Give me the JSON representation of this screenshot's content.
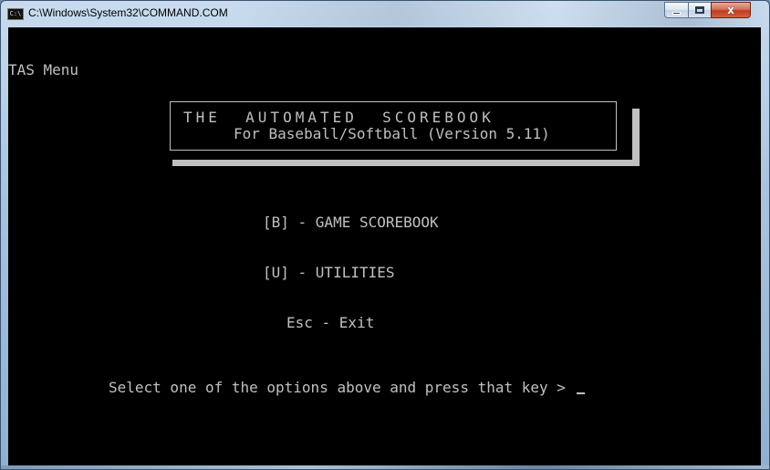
{
  "window": {
    "title": "C:\\Windows\\System32\\COMMAND.COM",
    "icon_text": "C:\\",
    "controls": {
      "minimize": "minimize-icon",
      "maximize": "maximize-icon",
      "close": "close-icon",
      "close_glyph": "x"
    }
  },
  "console": {
    "menu_title": "TAS Menu",
    "banner": {
      "title": "THE  AUTOMATED  SCOREBOOK",
      "subtitle": "For Baseball/Softball (Version 5.11)"
    },
    "options": [
      {
        "text": "[B] - GAME SCOREBOOK"
      },
      {
        "text": "[U] - UTILITIES"
      },
      {
        "text": "Esc - Exit"
      }
    ],
    "prompt": "Select one of the options above and press that key > "
  },
  "colors": {
    "console_bg": "#000000",
    "console_text": "#c0c0c0",
    "close_button": "#c13c1f"
  }
}
